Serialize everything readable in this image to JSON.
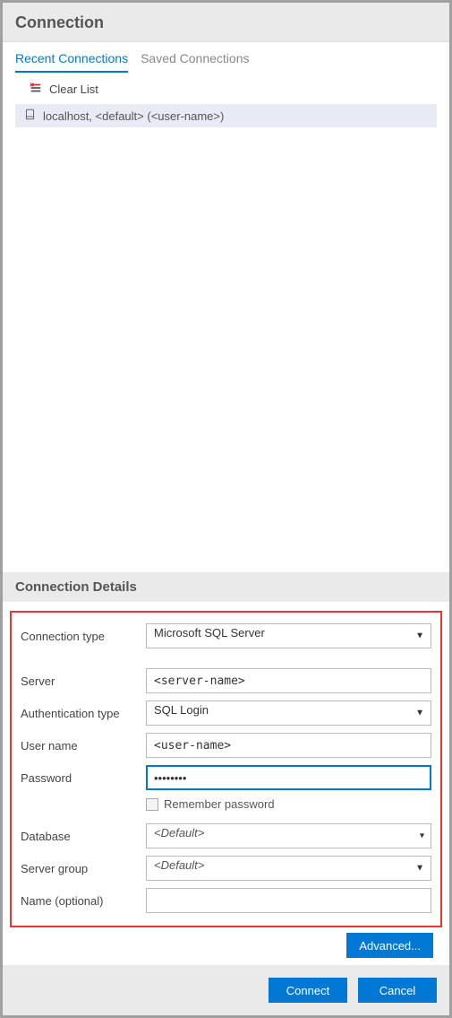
{
  "title": "Connection",
  "tabs": {
    "recent": "Recent Connections",
    "saved": "Saved Connections"
  },
  "clear_list": "Clear List",
  "connections": [
    {
      "label": "localhost, <default> (<user-name>)"
    }
  ],
  "details": {
    "header": "Connection Details",
    "labels": {
      "connection_type": "Connection type",
      "server": "Server",
      "auth_type": "Authentication type",
      "user_name": "User name",
      "password": "Password",
      "remember": "Remember password",
      "database": "Database",
      "server_group": "Server group",
      "name": "Name (optional)"
    },
    "values": {
      "connection_type": "Microsoft SQL Server",
      "server": "<server-name>",
      "auth_type": "SQL Login",
      "user_name": "<user-name>",
      "password": "••••••••",
      "database": "<Default>",
      "server_group": "<Default>",
      "name": ""
    }
  },
  "buttons": {
    "advanced": "Advanced...",
    "connect": "Connect",
    "cancel": "Cancel"
  }
}
